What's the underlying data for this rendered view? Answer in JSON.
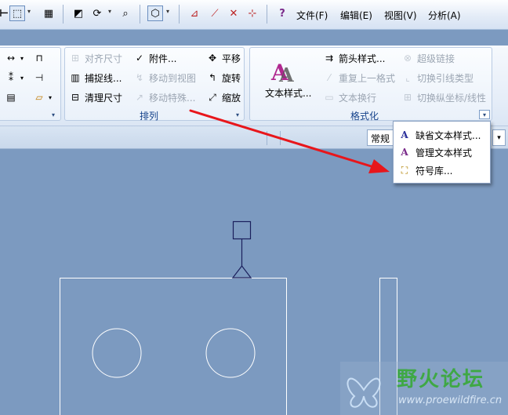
{
  "menu": {
    "file": "文件(F)",
    "edit": "编辑(E)",
    "view": "视图(V)",
    "analysis": "分析(A)"
  },
  "ribbon": {
    "arrange": {
      "label": "排列",
      "align_dims": "对齐尺寸",
      "capture_lines": "捕捉线...",
      "clean_dims": "清理尺寸",
      "attach": "附件...",
      "move_to_view": "移动到视图",
      "move_special": "移动特殊...",
      "translate": "平移",
      "rotate": "旋转",
      "scale": "缩放"
    },
    "format": {
      "label": "格式化",
      "text_style": "文本样式...",
      "arrow_style": "箭头样式...",
      "repeat_last_format": "重复上一格式",
      "text_wrap": "文本换行",
      "hyperlink": "超级链接",
      "toggle_leader_type": "切换引线类型",
      "toggle_ordinate": "切换纵坐标/线性"
    }
  },
  "view_strip": {
    "display_value": "常规"
  },
  "popup": {
    "default_text_style": "缺省文本样式...",
    "manage_text_style": "管理文本样式",
    "symbol_library": "符号库..."
  },
  "watermark": {
    "title": "野火论坛",
    "url": "www.proewildfire.cn"
  },
  "colors": {
    "canvas": "#7c9ac0",
    "arrow": "#e8161b",
    "drawing_lines": "#ffffff",
    "symbol_lines": "#1a1f5c",
    "group_label": "#15428b"
  }
}
